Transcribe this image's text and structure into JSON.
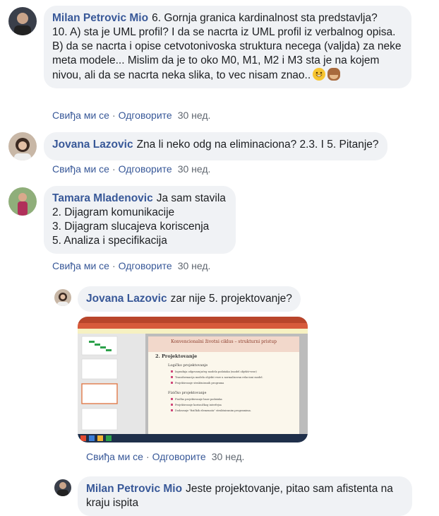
{
  "actions": {
    "like": "Свиђа ми се",
    "reply": "Одговорите",
    "separator": "·"
  },
  "comments": [
    {
      "author": "Milan Petrovic Mio",
      "text": "6. Gornja granica kardinalnost sta predstavlja?\n10. A) sta je UML profil? I da se nacrta iz UML profil iz verbalnog opisa.\nB) da se nacrta i opise cetvotonivoska struktura necega (valjda) za neke meta modele... Mislim da je to oko M0, M1, M2 i M3 sta je na kojem nivou, ali da se nacrta neka slika, to vec nisam znao..",
      "time": "30 нед.",
      "emojis": [
        "grinning-face-icon",
        "see-no-evil-monkey-icon"
      ]
    },
    {
      "author": "Jovana Lazovic",
      "text": "Zna li neko odg na eliminaciona? 2.3. I 5. Pitanje?",
      "time": "30 нед."
    },
    {
      "author": "Tamara Mladenovic",
      "text": "Ja sam stavila\n2. Dijagram komunikacije\n3. Dijagram slucajeva koriscenja\n5. Analiza i specifikacija",
      "time": "30 нед."
    },
    {
      "author": "Jovana Lazovic",
      "text": "zar nije 5. projektovanje?",
      "time": "30 нед."
    },
    {
      "author": "Milan Petrovic Mio",
      "text": "Jeste projektovanje, pitao sam afistenta na kraju ispita"
    }
  ],
  "slide": {
    "title": "Konvencionalni životni ciklus – strukturni pristup",
    "heading": "2. Projektovanje",
    "logical_title": "Logičko projektovanje",
    "logical_items": [
      "Izgradnja odgovarajućeg modela podataka (model objekti-veze)",
      "Transformacija modela objekti veze u normalizovan relacioni model.",
      "Projektovanje struktuiranih programa"
    ],
    "physical_title": "Fizičko projektovanje",
    "physical_items": [
      "Fizičko projektovanje baze podataka",
      "Projektovanje korisničkog interfejsa",
      "Dodavanje \"fizičkih elemenata\" struktuiranim programima."
    ]
  }
}
